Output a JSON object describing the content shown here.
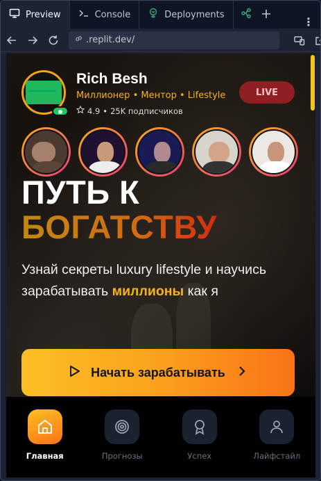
{
  "ide": {
    "tabs": [
      {
        "label": "Preview",
        "icon": "monitor-icon",
        "active": true
      },
      {
        "label": "Console",
        "icon": "terminal-icon",
        "active": false
      },
      {
        "label": "Deployments",
        "icon": "deploy-icon",
        "active": false
      }
    ],
    "url": ".replit.dev/"
  },
  "app": {
    "profile": {
      "name": "Rich Besh",
      "tags": "Миллионер • Ментор • Lifestyle",
      "rating": "4.9",
      "subscribers": "25K подписчиков",
      "live_label": "LIVE"
    },
    "hero": {
      "line1": "ПУТЬ К",
      "line2": "БОГАТСТВУ",
      "sub_before": "Узнай секреты luxury lifestyle и научись зарабатывать ",
      "sub_highlight": "миллионы",
      "sub_after": " как я"
    },
    "cta_label": "Начать зарабатывать",
    "nav": [
      {
        "label": "Главная",
        "icon": "home-icon",
        "active": true
      },
      {
        "label": "Прогнозы",
        "icon": "target-icon",
        "active": false
      },
      {
        "label": "Успех",
        "icon": "award-icon",
        "active": false
      },
      {
        "label": "Лайфстайл",
        "icon": "user-icon",
        "active": false
      }
    ]
  },
  "colors": {
    "accent": "#f5b21a",
    "cta_start": "#fbbf24",
    "cta_end": "#f97316",
    "live_bg": "#8f1f22"
  }
}
